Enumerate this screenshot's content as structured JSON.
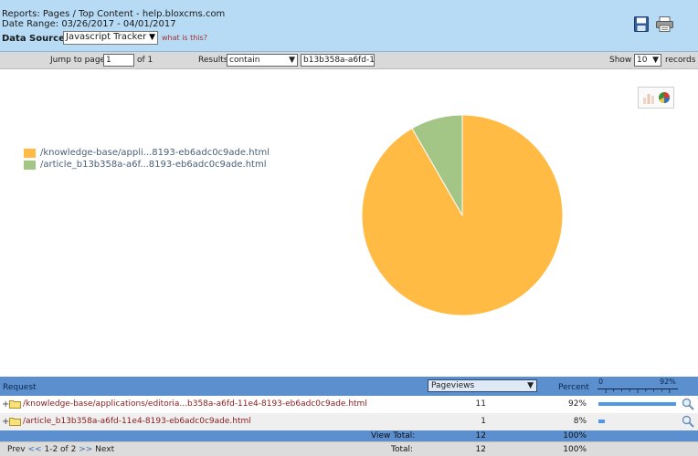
{
  "header": {
    "reports_line": "Reports: Pages / Top Content - help.bloxcms.com",
    "date_range": "Date Range: 03/26/2017 - 04/01/2017",
    "data_source_label": "Data Source:",
    "data_source_value": "Javascript Tracker",
    "what_is_this": "what is this?"
  },
  "toolbar": {
    "jump_label": "Jump to page",
    "page_value": "1",
    "of_pages": "of 1",
    "results_label": "Results",
    "filter_mode": "contain",
    "filter_text": "b13b358a-a6fd-1",
    "show_label": "Show",
    "show_value": "10",
    "records_label": "records"
  },
  "icons": {
    "save": "save-disk-icon",
    "print": "printer-icon",
    "bar_chart": "bar-chart-icon",
    "pie_chart": "pie-chart-icon",
    "magnifier": "magnifier-icon",
    "folder": "folder-icon",
    "dropdown": "chevron-down-icon"
  },
  "chart_data": {
    "type": "pie",
    "categories": [
      "/knowledge-base/appli...8193-eb6adc0c9ade.html",
      "/article_b13b358a-a6f...8193-eb6adc0c9ade.html"
    ],
    "values": [
      11,
      1
    ],
    "colors": [
      "#ffbb44",
      "#a3c585"
    ],
    "legend_position": "left"
  },
  "table": {
    "col_request": "Request",
    "metric": "Pageviews",
    "col_percent": "Percent",
    "scale_min": "0",
    "scale_max": "92%",
    "rows": [
      {
        "expand": "+",
        "request": "/knowledge-base/applications/editoria...b358a-a6fd-11e4-8193-eb6adc0c9ade.html",
        "pageviews": "11",
        "percent": "92%",
        "bar_fraction": 1.0
      },
      {
        "expand": "+",
        "request": "/article_b13b358a-a6fd-11e4-8193-eb6adc0c9ade.html",
        "pageviews": "1",
        "percent": "8%",
        "bar_fraction": 0.087
      }
    ],
    "view_total_label": "View Total:",
    "view_total_value": "12",
    "view_total_percent": "100%",
    "total_label": "Total:",
    "total_value": "12",
    "total_percent": "100%"
  },
  "pager": {
    "prev": "Prev",
    "prev_arrows": "<<",
    "range": "1-2 of 2",
    "next_arrows": ">>",
    "next": "Next"
  },
  "colors": {
    "header_bg": "#b7dbf5",
    "table_header_bg": "#5b8fce",
    "link_red": "#8b1a1a",
    "bar_blue": "#4f98e6"
  }
}
